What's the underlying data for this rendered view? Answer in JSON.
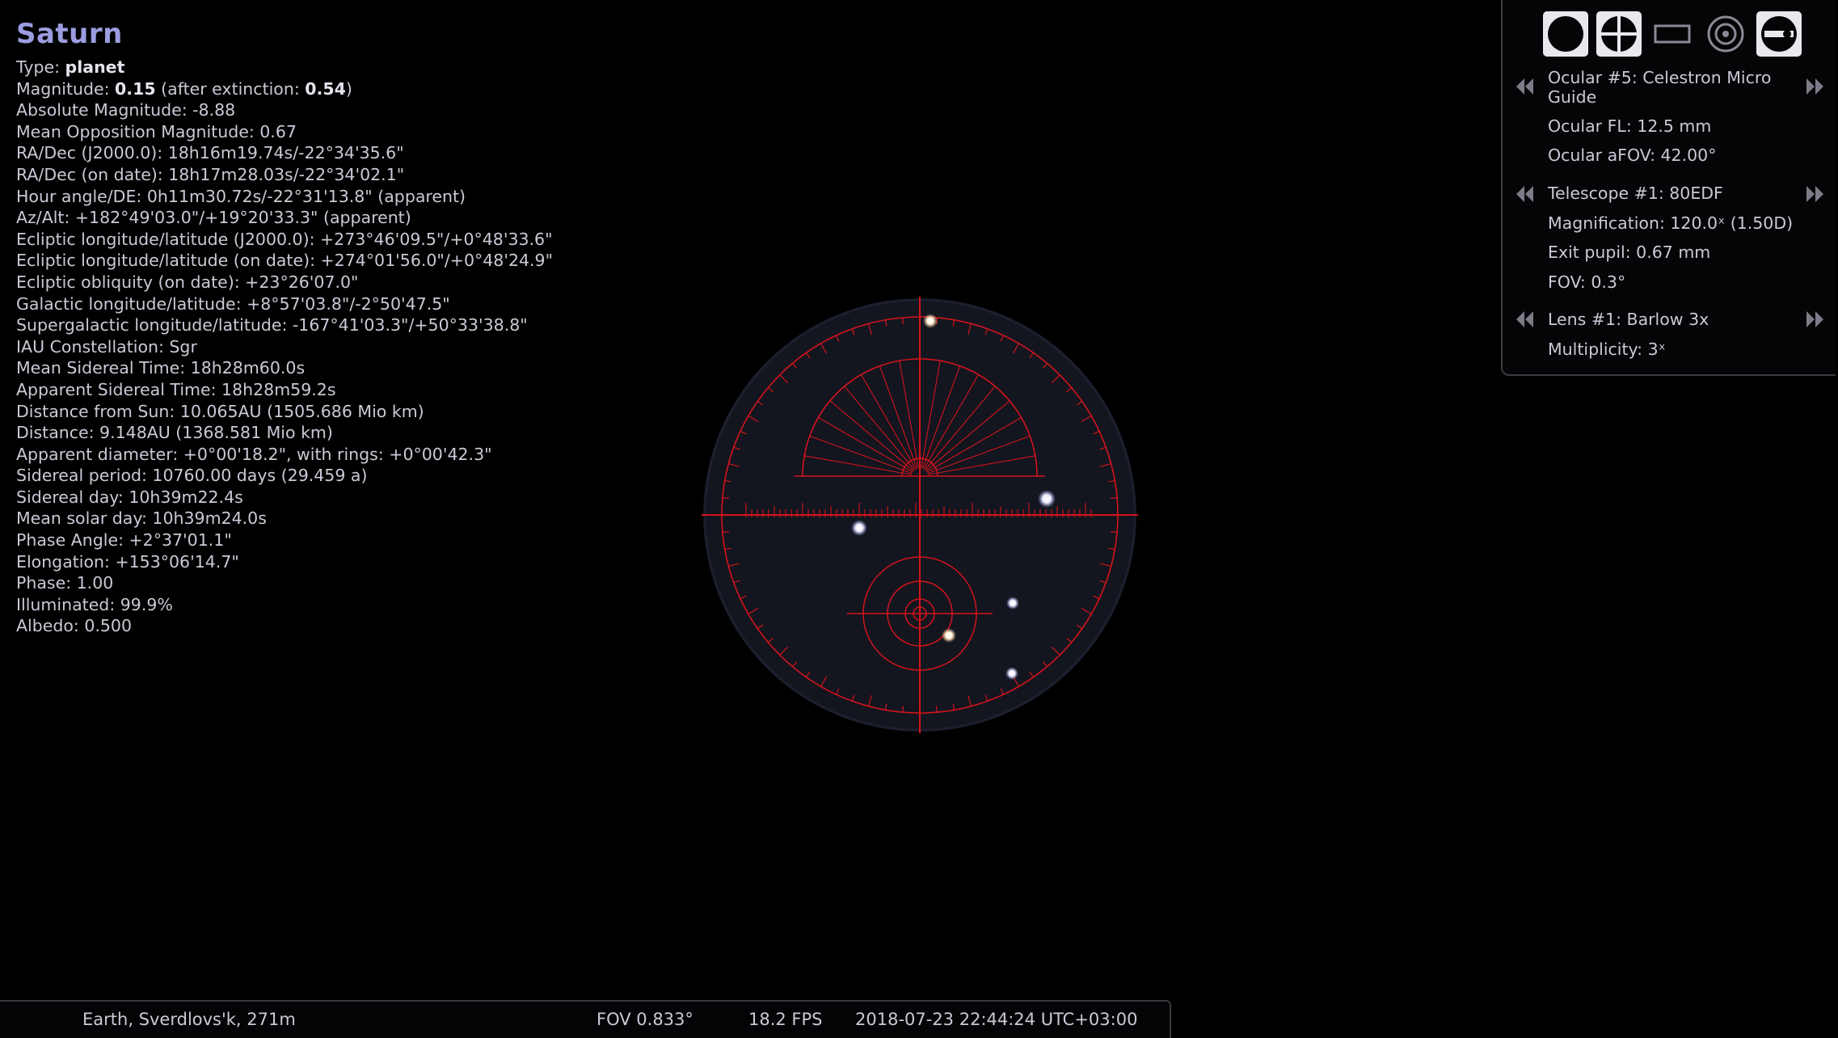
{
  "object": {
    "name": "Saturn",
    "type_label": "Type:",
    "type_value": "planet",
    "magnitude_label": "Magnitude:",
    "magnitude_value": "0.15",
    "magnitude_extinction_label": "(after extinction:",
    "magnitude_extinction_value": "0.54",
    "magnitude_close": ")",
    "lines": [
      "Absolute Magnitude: -8.88",
      "Mean Opposition Magnitude: 0.67",
      "RA/Dec (J2000.0): 18h16m19.74s/-22°34'35.6\"",
      "RA/Dec (on date): 18h17m28.03s/-22°34'02.1\"",
      "Hour angle/DE: 0h11m30.72s/-22°31'13.8\" (apparent)",
      "Az/Alt: +182°49'03.0\"/+19°20'33.3\" (apparent)",
      "Ecliptic longitude/latitude (J2000.0): +273°46'09.5\"/+0°48'33.6\"",
      "Ecliptic longitude/latitude (on date): +274°01'56.0\"/+0°48'24.9\"",
      "Ecliptic obliquity (on date): +23°26'07.0\"",
      "Galactic longitude/latitude: +8°57'03.8\"/-2°50'47.5\"",
      "Supergalactic longitude/latitude: -167°41'03.3\"/+50°33'38.8\"",
      "IAU Constellation: Sgr",
      "Mean Sidereal Time: 18h28m60.0s",
      "Apparent Sidereal Time: 18h28m59.2s",
      "Distance from Sun: 10.065AU (1505.686 Mio km)",
      "Distance: 9.148AU (1368.581 Mio km)",
      "Apparent diameter: +0°00'18.2\", with rings: +0°00'42.3\"",
      "Sidereal period: 10760.00 days (29.459 a)",
      "Sidereal day: 10h39m22.4s",
      "Mean solar day: 10h39m24.0s",
      "Phase Angle: +2°37'01.1\"",
      "Elongation: +153°06'14.7\"",
      "Phase: 1.00",
      "Illuminated: 99.9%",
      "Albedo: 0.500"
    ]
  },
  "ocular_panel": {
    "toolbar": [
      {
        "icon": "ocular-view-icon",
        "active": true
      },
      {
        "icon": "crosshair-icon",
        "active": true
      },
      {
        "icon": "ccd-frame-icon",
        "active": false
      },
      {
        "icon": "telrad-icon",
        "active": false
      },
      {
        "icon": "ocular-config-icon",
        "active": true
      }
    ],
    "ocular_line1": "Ocular #5: Celestron Micro",
    "ocular_line2": "Guide",
    "ocular_fl": "Ocular FL: 12.5 mm",
    "ocular_afov": "Ocular aFOV: 42.00°",
    "telescope": "Telescope #1: 80EDF",
    "magnification": "Magnification: 120.0ˣ (1.50D)",
    "exit_pupil": "Exit pupil: 0.67 mm",
    "fov": "FOV: 0.3°",
    "lens": "Lens #1: Barlow 3x",
    "multiplicity": "Multiplicity: 3ˣ"
  },
  "status_bar": {
    "location": "Earth, Sverdlovs'k, 271m",
    "fov": "FOV 0.833°",
    "fps": "18.2 FPS",
    "datetime": "2018-07-23 22:44:24 UTC+03:00"
  },
  "colors": {
    "reticle": "#d4141c",
    "field_bg": "#13151f",
    "title": "#9c9ce0"
  }
}
